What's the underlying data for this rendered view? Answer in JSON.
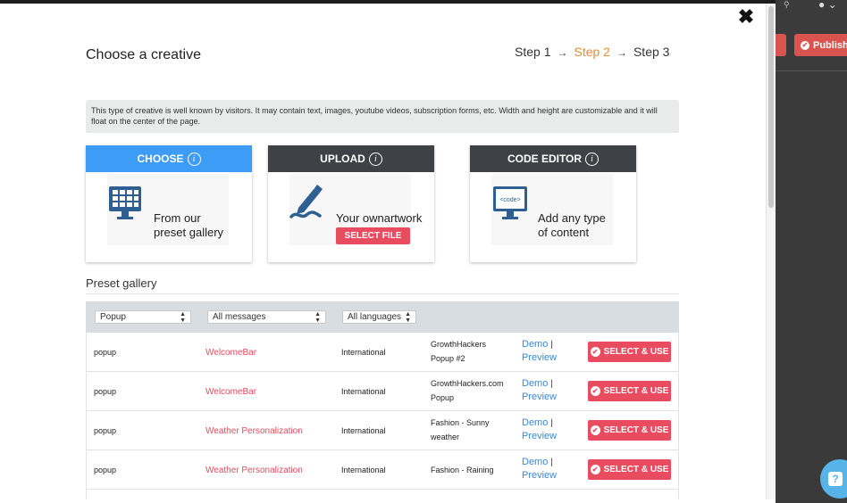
{
  "background": {
    "publish_label": "Publish"
  },
  "modal": {
    "title": "Choose a creative",
    "close_symbol": "✖",
    "steps": {
      "step1": "Step 1",
      "step2": "Step 2",
      "step3": "Step 3",
      "arrow": "→",
      "active_color": "#e88a2e"
    },
    "info_text": "This type of creative is well known by visitors. It may contain text, images, youtube videos, subscription forms, etc. Width and height are customizable and it will float on the center of the page."
  },
  "cards": {
    "choose": {
      "header": "CHOOSE",
      "header_color": "#3d9cf5",
      "line1": "From our",
      "line2": "preset gallery",
      "icon": "gallery-monitor-icon"
    },
    "upload": {
      "header": "UPLOAD",
      "header_color": "#3e4246",
      "line1": "Your ownartwork",
      "button": "SELECT FILE",
      "icon": "pen-icon"
    },
    "code_editor": {
      "header": "CODE EDITOR",
      "header_color": "#3e4246",
      "line1": "Add any type",
      "line2": "of content",
      "icon": "code-monitor-icon",
      "code_tag": "<code>"
    },
    "info_symbol": "i"
  },
  "gallery": {
    "title": "Preset gallery",
    "filters": {
      "type": "Popup",
      "messages": "All messages",
      "languages": "All languages"
    },
    "select_label": "SELECT & USE",
    "demo_label": "Demo",
    "demo_sep": "|",
    "preview_label": "Preview",
    "rows": [
      {
        "type": "popup",
        "name": "WelcomeBar",
        "region": "International",
        "title_line1": "GrowthHackers",
        "title_line2": "Popup #2"
      },
      {
        "type": "popup",
        "name": "WelcomeBar",
        "region": "International",
        "title_line1": "GrowthHackers.com",
        "title_line2": "Popup"
      },
      {
        "type": "popup",
        "name": "Weather Personalization",
        "region": "International",
        "title_line1": "Fashion - Sunny",
        "title_line2": "weather"
      },
      {
        "type": "popup",
        "name": "Weather Personalization",
        "region": "International",
        "title_line1": "Fashion - Raining",
        "title_line2": ""
      }
    ],
    "accent_color": "#e94b5f",
    "link_color": "#3a87d4"
  }
}
